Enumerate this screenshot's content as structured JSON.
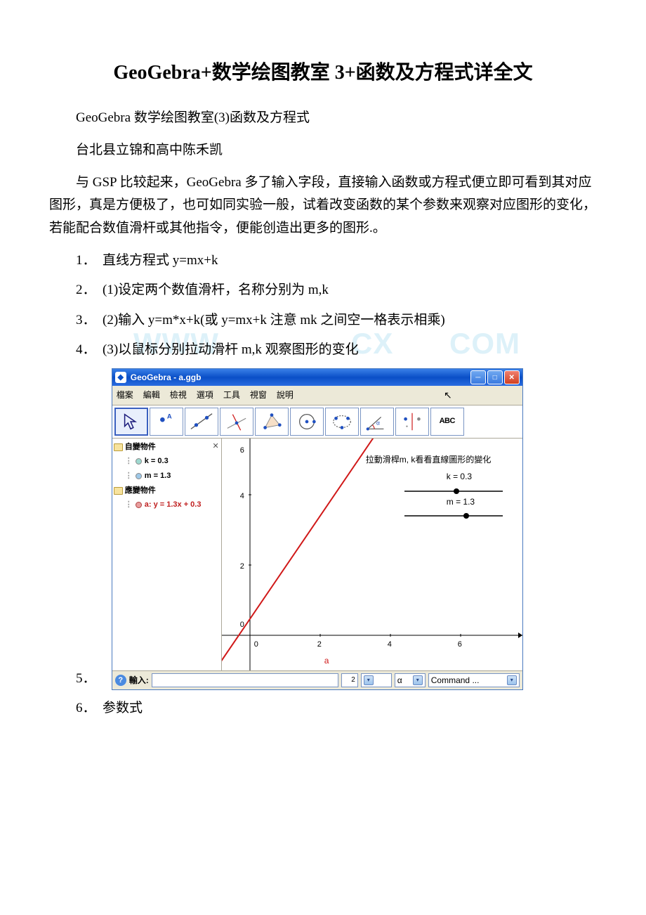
{
  "title": "GeoGebra+数学绘图教室 3+函数及方程式详全文",
  "subtitle": "GeoGebra 数学绘图教室(3)函数及方程式",
  "author": "台北县立锦和高中陈禾凯",
  "intro": "与 GSP 比较起来，GeoGebra 多了输入字段，直接输入函数或方程式便立即可看到其对应图形，真是方便极了，也可如同实验一般，试着改变函数的某个参数来观察对应图形的变化，若能配合数值滑杆或其他指令，便能创造出更多的图形.。",
  "list": {
    "n1": "1．",
    "i1": "直线方程式 y=mx+k",
    "n2": "2．",
    "i2": "(1)设定两个数值滑杆，名称分别为 m,k",
    "n3": "3．",
    "i3": "(2)输入 y=m*x+k(或 y=mx+k 注意 mk 之间空一格表示相乘)",
    "n4": "4．",
    "i4": "(3)以鼠标分别拉动滑杆 m,k 观察图形的变化",
    "n5": "5．",
    "n6": "6．",
    "i6": "参数式"
  },
  "watermark1": "WWW",
  "watermark2": "CX",
  "watermark3": "COM",
  "window": {
    "title": "GeoGebra - a.ggb",
    "menu": {
      "m1": "檔案",
      "m2": "編輯",
      "m3": "檢視",
      "m4": "選項",
      "m5": "工具",
      "m6": "視窗",
      "m7": "說明"
    },
    "algebra": {
      "folder1": "自變物件",
      "k_item": "k = 0.3",
      "m_item": "m = 1.3",
      "folder2": "應變物件",
      "eq_item": "a: y = 1.3x + 0.3"
    },
    "graph": {
      "hint": "拉動滑桿m, k看看直線圖形的變化",
      "slider_k": "k = 0.3",
      "slider_m": "m = 1.3",
      "tick0": "0",
      "tick2x": "2",
      "tick4x": "4",
      "tick6x": "6",
      "tick2y": "2",
      "tick4y": "4",
      "tick6y": "6",
      "line_label": "a"
    },
    "inputbar": {
      "label": "輸入:",
      "sup": "2",
      "alpha": "α",
      "cmd": "Command ..."
    },
    "tool_text": "ABC"
  },
  "chart_data": {
    "type": "line",
    "title": "y = 1.3x + 0.3",
    "xlabel": "",
    "ylabel": "",
    "xlim": [
      -1,
      7
    ],
    "ylim": [
      -1,
      7
    ],
    "parameters": {
      "m": 1.3,
      "k": 0.3
    },
    "series": [
      {
        "name": "a",
        "equation": "y = 1.3x + 0.3",
        "x": [
          -1,
          5.15
        ],
        "y": [
          -1,
          7
        ],
        "color": "#d01818"
      }
    ],
    "sliders": [
      {
        "name": "k",
        "value": 0.3,
        "min": -5,
        "max": 5
      },
      {
        "name": "m",
        "value": 1.3,
        "min": -5,
        "max": 5
      }
    ],
    "x_ticks": [
      0,
      2,
      4,
      6
    ],
    "y_ticks": [
      0,
      2,
      4,
      6
    ]
  }
}
